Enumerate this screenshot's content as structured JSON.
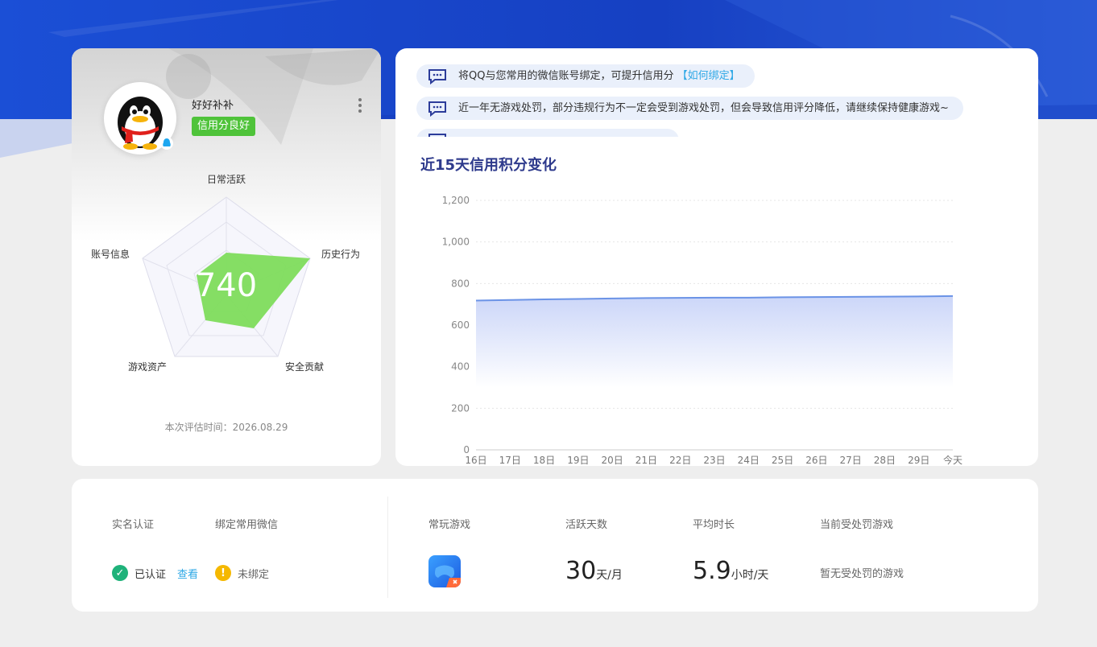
{
  "profile": {
    "username": "好好补补",
    "score_badge": "信用分良好",
    "score": "740",
    "radar_labels": {
      "daily": "日常活跃",
      "history": "历史行为",
      "security": "安全贡献",
      "assets": "游戏资产",
      "account": "账号信息"
    },
    "eval_time": "本次评估时间：2026.08.29"
  },
  "notices": [
    {
      "text": "将QQ与您常用的微信账号绑定，可提升信用分",
      "link": "【如何绑定】"
    },
    {
      "text": "近一年无游戏处罚，部分违规行为不一定会受到游戏处罚，但会导致信用评分降低，请继续保持健康游戏~",
      "link": ""
    },
    {
      "text": "",
      "link": ""
    }
  ],
  "trend": {
    "title": "近15天信用积分变化"
  },
  "chart_data": {
    "type": "area",
    "title": "",
    "xlabel": "",
    "ylabel": "",
    "x": [
      "16日",
      "17日",
      "18日",
      "19日",
      "20日",
      "21日",
      "22日",
      "23日",
      "24日",
      "25日",
      "26日",
      "27日",
      "28日",
      "29日",
      "今天"
    ],
    "series": [
      {
        "values": [
          718,
          721,
          724,
          726,
          728,
          730,
          731,
          732,
          732,
          734,
          735,
          736,
          737,
          738,
          740
        ]
      }
    ],
    "ylim": [
      0,
      1200
    ],
    "yticks": [
      0,
      200,
      400,
      600,
      800,
      1000,
      1200
    ],
    "ytick_labels": [
      "0",
      "200",
      "400",
      "600",
      "800",
      "1,000",
      "1,200"
    ],
    "grid": true,
    "line_color": "#6b93e6"
  },
  "stats": {
    "realname_label": "实名认证",
    "wechat_label": "绑定常用微信",
    "realname_status": "已认证",
    "view_link": "查看",
    "wechat_status": "未绑定",
    "games_label": "常玩游戏",
    "active_days_label": "活跃天数",
    "active_days_value": "30",
    "active_days_unit": "天/月",
    "avg_time_label": "平均时长",
    "avg_time_value": "5.9",
    "avg_time_unit": "小时/天",
    "penalty_label": "当前受处罚游戏",
    "penalty_value": "暂无受处罚的游戏"
  },
  "colors": {
    "header_blue": "#1a47c8",
    "success": "#27b37a",
    "warning": "#f5b800",
    "badge_green": "#4fc33a"
  }
}
